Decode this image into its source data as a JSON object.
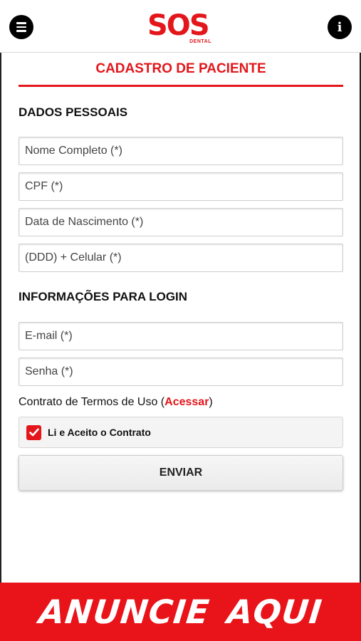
{
  "header": {
    "logo_text": "SOS",
    "logo_subtext": "DENTAL",
    "menu_icon": "hamburger-menu-icon",
    "info_icon": "info-icon",
    "info_glyph": "i"
  },
  "page": {
    "title": "CADASTRO DE PACIENTE"
  },
  "personal": {
    "section_title": "DADOS PESSOAIS",
    "name_placeholder": "Nome Completo (*)",
    "cpf_placeholder": "CPF (*)",
    "birth_placeholder": "Data de Nascimento (*)",
    "phone_placeholder": "(DDD) + Celular (*)"
  },
  "login": {
    "section_title": "INFORMAÇÕES PARA LOGIN",
    "email_placeholder": "E-mail (*)",
    "password_placeholder": "Senha (*)"
  },
  "terms": {
    "prefix": "Contrato de Termos de Uso (",
    "link_label": "Acessar",
    "suffix": ")",
    "accept_label": "Li e Aceito o Contrato",
    "accepted": true
  },
  "form": {
    "submit_label": "ENVIAR"
  },
  "banner": {
    "text": "ANUNCIE AQUI"
  },
  "colors": {
    "accent": "#e3161b",
    "banner": "#e8141a"
  }
}
